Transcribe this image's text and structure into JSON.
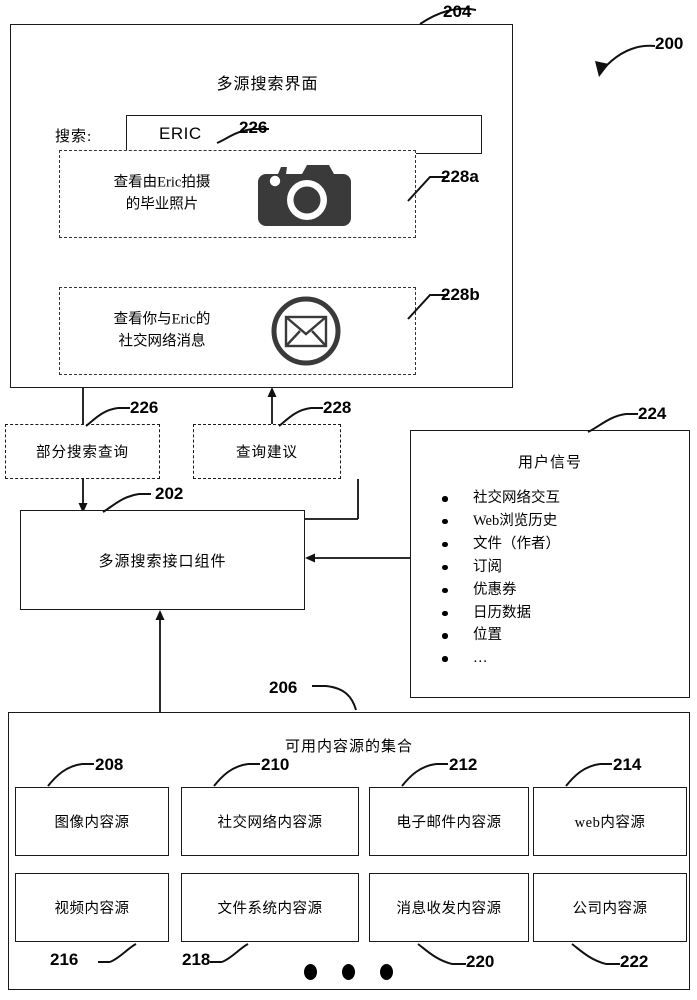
{
  "figure": {
    "overall_ref": "200",
    "ui_panel_ref": "204",
    "component_ref": "202",
    "partial_query_ref": "226",
    "query_suggestions_ref": "228",
    "user_signals_ref": "224",
    "sources_ref": "206"
  },
  "ui_panel": {
    "title": "多源搜索界面",
    "search_label": "搜索:",
    "search_value": "ERIC",
    "search_value_ref": "226",
    "suggestions": [
      {
        "text_line1": "查看由Eric拍摄",
        "text_line2": "的毕业照片",
        "icon": "camera-icon",
        "ref": "228a"
      },
      {
        "text_line1": "查看你与Eric的",
        "text_line2": "社交网络消息",
        "icon": "envelope-circle-icon",
        "ref": "228b"
      }
    ]
  },
  "middle": {
    "partial_query_label": "部分搜索查询",
    "partial_query_ref": "226",
    "query_suggestion_label": "查询建议",
    "query_suggestion_ref": "228",
    "component_label": "多源搜索接口组件",
    "component_ref": "202"
  },
  "user_signals": {
    "title": "用户信号",
    "ref": "224",
    "items": [
      "社交网络交互",
      "Web浏览历史",
      "文件（作者）",
      "订阅",
      "优惠券",
      "日历数据",
      "位置",
      "…"
    ]
  },
  "content_sources": {
    "title": "可用内容源的集合",
    "ref": "206",
    "row1": [
      {
        "label": "图像内容源",
        "ref": "208"
      },
      {
        "label": "社交网络内容源",
        "ref": "210"
      },
      {
        "label": "电子邮件内容源",
        "ref": "212"
      },
      {
        "label": "web内容源",
        "ref": "214"
      }
    ],
    "row2": [
      {
        "label": "视频内容源",
        "ref": "216"
      },
      {
        "label": "文件系统内容源",
        "ref": "218"
      },
      {
        "label": "消息收发内容源",
        "ref": "220"
      },
      {
        "label": "公司内容源",
        "ref": "222"
      }
    ],
    "more_indicator": "•••"
  },
  "colors": {
    "line": "#1a1a1a",
    "icon_fill": "#3a3a3a",
    "background": "#ffffff"
  }
}
